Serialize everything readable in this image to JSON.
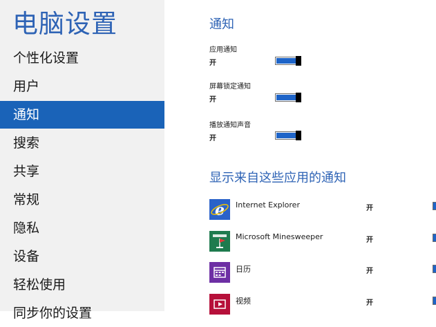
{
  "sidebar": {
    "title": "电脑设置",
    "items": [
      {
        "label": "个性化设置"
      },
      {
        "label": "用户"
      },
      {
        "label": "通知",
        "selected": true
      },
      {
        "label": "搜索"
      },
      {
        "label": "共享"
      },
      {
        "label": "常规"
      },
      {
        "label": "隐私"
      },
      {
        "label": "设备"
      },
      {
        "label": "轻松使用"
      },
      {
        "label": "同步你的设置"
      }
    ]
  },
  "main": {
    "section_title": "通知",
    "settings": [
      {
        "label": "应用通知",
        "state": "开",
        "on": true
      },
      {
        "label": "屏幕锁定通知",
        "state": "开",
        "on": true
      },
      {
        "label": "播放通知声音",
        "state": "开",
        "on": true
      }
    ],
    "apps_title": "显示来自这些应用的通知",
    "apps": [
      {
        "name": "Internet Explorer",
        "state": "开",
        "icon": "internet-explorer-icon",
        "color": "#2a62c9"
      },
      {
        "name": "Microsoft Minesweeper",
        "state": "开",
        "icon": "minesweeper-icon",
        "color": "#1e7b4e"
      },
      {
        "name": "日历",
        "state": "开",
        "icon": "calendar-icon",
        "color": "#6d2fa4"
      },
      {
        "name": "视频",
        "state": "开",
        "icon": "video-icon",
        "color": "#b6103a"
      }
    ]
  },
  "colors": {
    "accent": "#2e63b5",
    "selected_background": "#1a63b8",
    "sidebar_background": "#f1f1f1",
    "toggle_on": "#1e64c8"
  }
}
